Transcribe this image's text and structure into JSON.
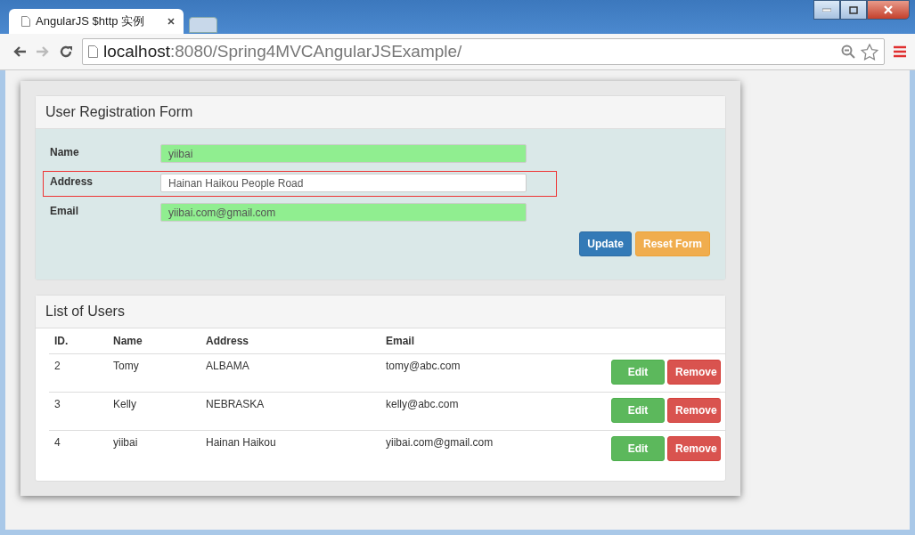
{
  "browser": {
    "tab_title": "AngularJS $http 实例",
    "url_host": "localhost",
    "url_path": ":8080/Spring4MVCAngularJSExample/"
  },
  "form": {
    "title": "User Registration Form",
    "fields": [
      {
        "label": "Name",
        "value": "yiibai",
        "valid": true,
        "highlighted": false
      },
      {
        "label": "Address",
        "value": "Hainan Haikou People Road",
        "valid": false,
        "highlighted": true
      },
      {
        "label": "Email",
        "value": "yiibai.com@gmail.com",
        "valid": true,
        "highlighted": false
      }
    ],
    "buttons": [
      {
        "label": "Update",
        "kind": "primary"
      },
      {
        "label": "Reset Form",
        "kind": "warning"
      }
    ]
  },
  "users": {
    "title": "List of Users",
    "columns": [
      "ID.",
      "Name",
      "Address",
      "Email"
    ],
    "rows": [
      {
        "cells": [
          "2",
          "Tomy",
          "ALBAMA",
          "tomy@abc.com"
        ],
        "actions": [
          "Edit",
          "Remove"
        ]
      },
      {
        "cells": [
          "3",
          "Kelly",
          "NEBRASKA",
          "kelly@abc.com"
        ],
        "actions": [
          "Edit",
          "Remove"
        ]
      },
      {
        "cells": [
          "4",
          "yiibai",
          "Hainan Haikou",
          "yiibai.com@gmail.com"
        ],
        "actions": [
          "Edit",
          "Remove"
        ]
      }
    ]
  }
}
